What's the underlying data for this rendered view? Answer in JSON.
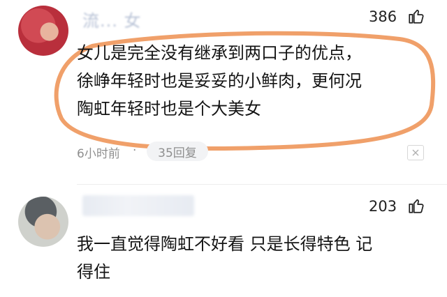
{
  "comments": [
    {
      "username": "流... 女",
      "likes": "386",
      "lines": [
        "女儿是完全没有继承到两口子的优点，",
        "徐峥年轻时也是妥妥的小鲜肉，更何况",
        "陶虹年轻时也是个大美女"
      ],
      "time": "6小时前",
      "separator": "·",
      "replies": "35回复"
    },
    {
      "username": "",
      "likes": "203",
      "lines": [
        "我一直觉得陶虹不好看 只是长得特色 记",
        "得住"
      ]
    }
  ],
  "colors": {
    "highlight_ring": "#f0a06a",
    "meta_gray": "#8f8f8f",
    "reply_pill_bg": "#f2f3f5"
  },
  "icons": {
    "like": "thumbs-up-icon",
    "more": "close-x-icon"
  }
}
